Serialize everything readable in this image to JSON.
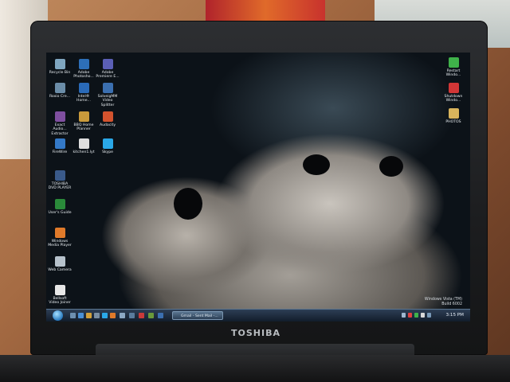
{
  "photo": {
    "laptop_brand": "TOSHIBA"
  },
  "desktop": {
    "icons_left": [
      {
        "label": "Recycle Bin",
        "color": "#7fa6c0",
        "icon": "recycle-bin-icon"
      },
      {
        "label": "Adobe Photosho...",
        "color": "#2d6fb8",
        "icon": "photoshop-icon"
      },
      {
        "label": "Adobe Premiere E...",
        "color": "#5b5fb6",
        "icon": "premiere-icon"
      },
      {
        "label": "Roxio Cre...",
        "color": "#6b8da8",
        "icon": "roxio-icon"
      },
      {
        "label": "Intel® Home...",
        "color": "#2a6ab8",
        "icon": "intel-icon"
      },
      {
        "label": "SolveigMM Video Splitter",
        "color": "#3b6fb0",
        "icon": "video-splitter-icon"
      },
      {
        "label": "Exact Audio... Extractor",
        "color": "#7f4fa0",
        "icon": "audio-extractor-icon"
      },
      {
        "label": "BBQ Home Planner",
        "color": "#c99a3b",
        "icon": "home-planner-icon"
      },
      {
        "label": "Audacity",
        "color": "#d3532e",
        "icon": "audacity-icon"
      },
      {
        "label": "FireWire",
        "color": "#3479c7",
        "icon": "firewire-icon"
      },
      {
        "label": "kitchen1.lyt",
        "color": "#dedede",
        "icon": "file-icon"
      },
      {
        "label": "Skype",
        "color": "#2aa8e8",
        "icon": "skype-icon"
      },
      {
        "label": "TOSHIBA DVD PLAYER",
        "color": "#3a5a8a",
        "icon": "dvd-player-icon"
      },
      {
        "label": "User's Guide",
        "color": "#2a8a3a",
        "icon": "guide-icon"
      },
      {
        "label": "Windows Media Player",
        "color": "#e07a2a",
        "icon": "media-player-icon"
      },
      {
        "label": "Web Camera",
        "color": "#b7c2cc",
        "icon": "camera-icon"
      },
      {
        "label": "Bellsoft Video Joiner",
        "color": "#e6e6e6",
        "icon": "video-joiner-icon"
      }
    ],
    "icons_right": [
      {
        "label": "Restart Windo...",
        "color": "#3fb24a",
        "icon": "restart-icon"
      },
      {
        "label": "Shutdown Windo...",
        "color": "#d13636",
        "icon": "shutdown-icon"
      },
      {
        "label": "PHOTOS",
        "color": "#d9b45c",
        "icon": "folder-icon"
      }
    ],
    "watermark": [
      "Windows Vista (TM)",
      "Build 6002"
    ],
    "taskbar": {
      "task_label": "Gmail - Sent Mail -...",
      "clock": "3:15 PM"
    }
  }
}
